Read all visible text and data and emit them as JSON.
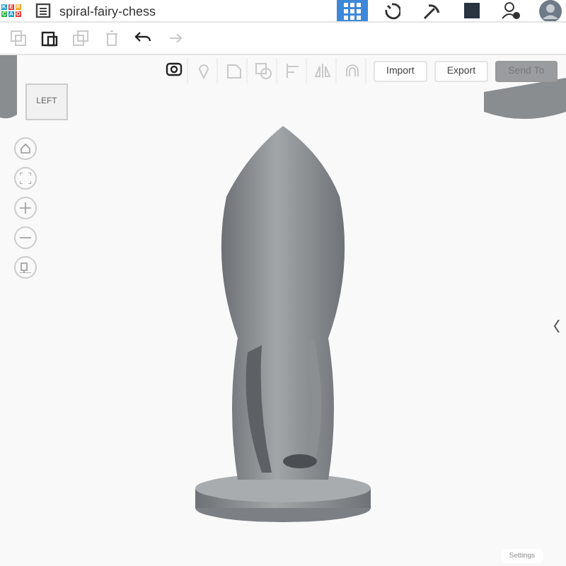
{
  "logo": {
    "letters": [
      "K",
      "E",
      "R",
      "C",
      "A",
      "D"
    ]
  },
  "document": {
    "title": "spiral-fairy-chess"
  },
  "header_icons": [
    {
      "kind": "grid",
      "selected": true
    },
    {
      "kind": "blocks",
      "selected": false
    },
    {
      "kind": "pickaxe",
      "selected": false
    },
    {
      "kind": "square",
      "selected": false
    },
    {
      "kind": "add-user",
      "selected": false
    },
    {
      "kind": "avatar",
      "selected": false
    }
  ],
  "edit_tools": [
    {
      "kind": "copy",
      "disabled": true
    },
    {
      "kind": "paste",
      "disabled": false
    },
    {
      "kind": "duplicate",
      "disabled": true
    },
    {
      "kind": "delete",
      "disabled": true
    },
    {
      "kind": "undo",
      "disabled": false
    },
    {
      "kind": "redo",
      "disabled": true
    }
  ],
  "shape_tools": [
    {
      "kind": "note",
      "disabled": false
    },
    {
      "kind": "ruler",
      "disabled": true
    },
    {
      "kind": "group",
      "disabled": true
    },
    {
      "kind": "hole",
      "disabled": true
    },
    {
      "kind": "align",
      "disabled": true
    },
    {
      "kind": "mirror",
      "disabled": true
    },
    {
      "kind": "magnet",
      "disabled": true
    }
  ],
  "action_buttons": [
    {
      "label": "Import",
      "disabled": false
    },
    {
      "label": "Export",
      "disabled": false
    },
    {
      "label": "Send To",
      "disabled": true
    }
  ],
  "view_cube": {
    "face": "LEFT"
  },
  "nav_buttons": [
    {
      "kind": "home"
    },
    {
      "kind": "fit"
    },
    {
      "kind": "zoom-in"
    },
    {
      "kind": "zoom-out"
    },
    {
      "kind": "ortho"
    }
  ],
  "settings_button": "Settings"
}
